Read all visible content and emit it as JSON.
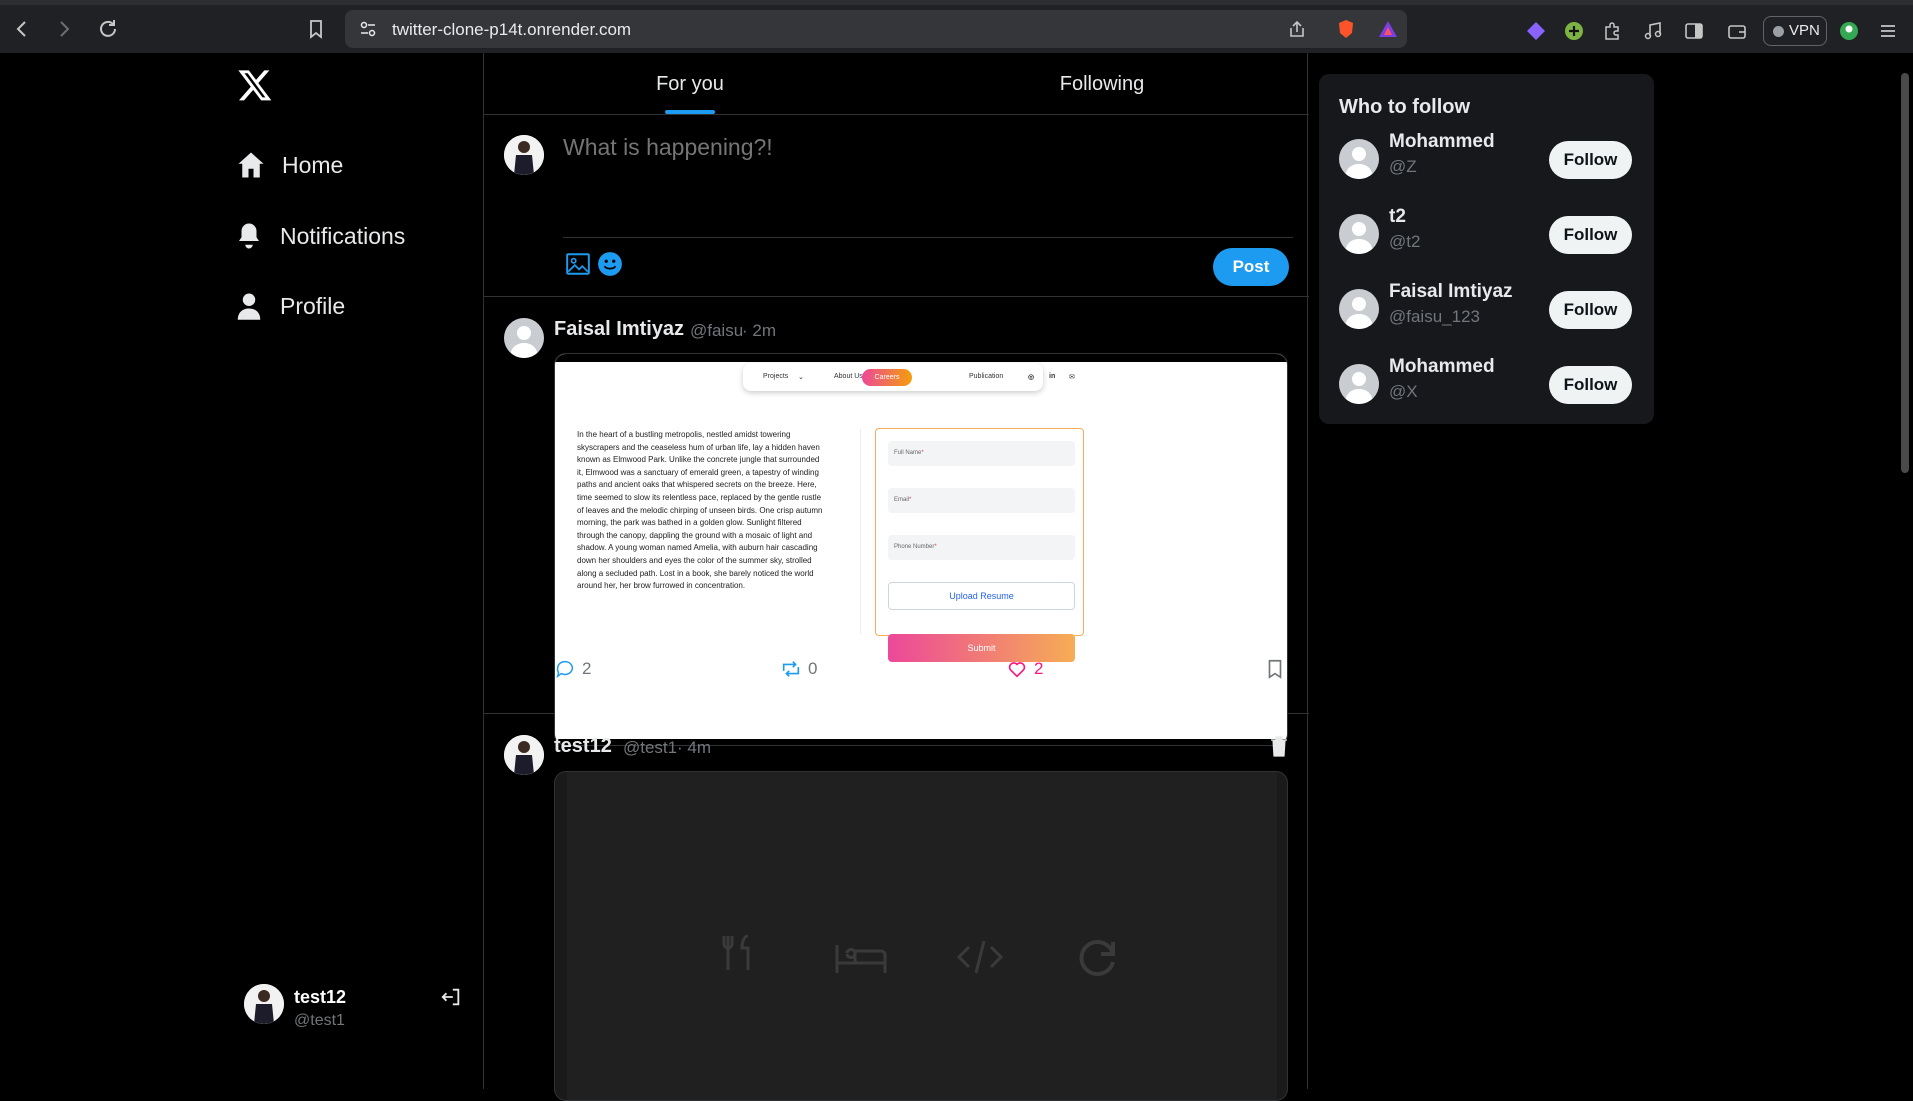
{
  "browser": {
    "url": "twitter-clone-p14t.onrender.com",
    "vpn_label": "VPN"
  },
  "sidebar": {
    "logo": "x-logo-icon",
    "items": [
      {
        "label": "Home",
        "icon": "home-icon"
      },
      {
        "label": "Notifications",
        "icon": "bell-icon"
      },
      {
        "label": "Profile",
        "icon": "user-icon"
      }
    ],
    "current_user": {
      "name": "test12",
      "handle": "@test1"
    }
  },
  "feed": {
    "tabs": [
      {
        "label": "For you",
        "active": true
      },
      {
        "label": "Following",
        "active": false
      }
    ],
    "composer": {
      "placeholder": "What is happening?!",
      "post_label": "Post"
    },
    "posts": [
      {
        "name": "Faisal Imtiyaz",
        "handle": "@faisu",
        "time": "· 2m",
        "comments": "2",
        "reposts": "0",
        "likes": "2",
        "image": {
          "nav": [
            "Projects",
            "About Us",
            "Careers",
            "Publication"
          ],
          "body_text": "In the heart of a bustling metropolis, nestled amidst towering skyscrapers and the ceaseless hum of urban life, lay a hidden haven known as Elmwood Park. Unlike the concrete jungle that surrounded it, Elmwood was a sanctuary of emerald green, a tapestry of winding paths and ancient oaks that whispered secrets on the breeze. Here, time seemed to slow its relentless pace, replaced by the gentle rustle of leaves and the melodic chirping of unseen birds. One crisp autumn morning, the park was bathed in a golden glow. Sunlight filtered through the canopy, dappling the ground with a mosaic of light and shadow. A young woman named Amelia, with auburn hair cascading down her shoulders and eyes the color of the summer sky, strolled along a secluded path. Lost in a book, she barely noticed the world around her, her brow furrowed in concentration.",
          "fields": [
            "Full Name",
            "Email",
            "Phone Number"
          ],
          "required_mark": "*",
          "upload_label": "Upload Resume",
          "submit_label": "Submit"
        }
      },
      {
        "name": "test12",
        "handle": "@test1",
        "time": "· 4m"
      }
    ]
  },
  "who_to_follow": {
    "title": "Who to follow",
    "follow_label": "Follow",
    "users": [
      {
        "name": "Mohammed",
        "handle": "@Z"
      },
      {
        "name": "t2",
        "handle": "@t2"
      },
      {
        "name": "Faisal Imtiyaz",
        "handle": "@faisu_123"
      },
      {
        "name": "Mohammed",
        "handle": "@X"
      }
    ]
  },
  "colors": {
    "accent": "#1d9bf0",
    "like": "#f91880",
    "background": "#000000"
  }
}
